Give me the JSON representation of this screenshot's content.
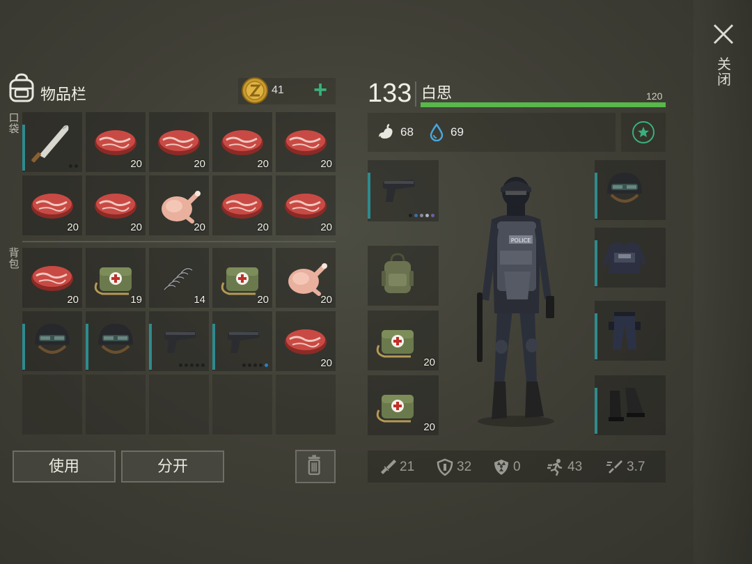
{
  "inventory": {
    "title": "物品栏",
    "pocket_label": "口袋",
    "backpack_label": "背包",
    "coins": "41",
    "add_coins": "+",
    "pocket_slots": [
      {
        "item": "machete",
        "qty": ""
      },
      {
        "item": "steak",
        "qty": "20"
      },
      {
        "item": "steak",
        "qty": "20"
      },
      {
        "item": "steak",
        "qty": "20"
      },
      {
        "item": "steak",
        "qty": "20"
      },
      {
        "item": "steak",
        "qty": "20"
      },
      {
        "item": "steak",
        "qty": "20"
      },
      {
        "item": "chicken",
        "qty": "20"
      },
      {
        "item": "steak",
        "qty": "20"
      },
      {
        "item": "steak",
        "qty": "20"
      }
    ],
    "backpack_slots": [
      {
        "item": "steak",
        "qty": "20"
      },
      {
        "item": "medkit",
        "qty": "19"
      },
      {
        "item": "spring",
        "qty": "14"
      },
      {
        "item": "medkit",
        "qty": "20"
      },
      {
        "item": "chicken",
        "qty": "20"
      },
      {
        "item": "helmet",
        "qty": ""
      },
      {
        "item": "helmet",
        "qty": ""
      },
      {
        "item": "pistol",
        "qty": ""
      },
      {
        "item": "pistol",
        "qty": ""
      },
      {
        "item": "steak",
        "qty": "20"
      },
      {
        "item": "",
        "qty": ""
      },
      {
        "item": "",
        "qty": ""
      },
      {
        "item": "",
        "qty": ""
      },
      {
        "item": "",
        "qty": ""
      },
      {
        "item": "",
        "qty": ""
      }
    ],
    "use_button": "使用",
    "split_button": "分开"
  },
  "character": {
    "level": "133",
    "name": "白思",
    "hp_max": "120",
    "hp_fraction": 1.0,
    "hunger": "68",
    "thirst": "69",
    "weapon_slots": [
      {
        "item": "pistol",
        "qty": ""
      },
      {
        "item": "backpack",
        "qty": ""
      },
      {
        "item": "medkit",
        "qty": "20"
      },
      {
        "item": "medkit",
        "qty": "20"
      }
    ],
    "armor_slots": [
      {
        "item": "helmet"
      },
      {
        "item": "vest"
      },
      {
        "item": "pants"
      },
      {
        "item": "boots"
      }
    ],
    "stats": {
      "attack": "21",
      "defense": "32",
      "radiation": "0",
      "speed": "43",
      "attack_speed": "3.7"
    }
  },
  "close_label": "关闭",
  "colors": {
    "accent_green": "#38b17a",
    "hp_green": "#58b84a",
    "teal_bar": "#2e8b8e"
  }
}
